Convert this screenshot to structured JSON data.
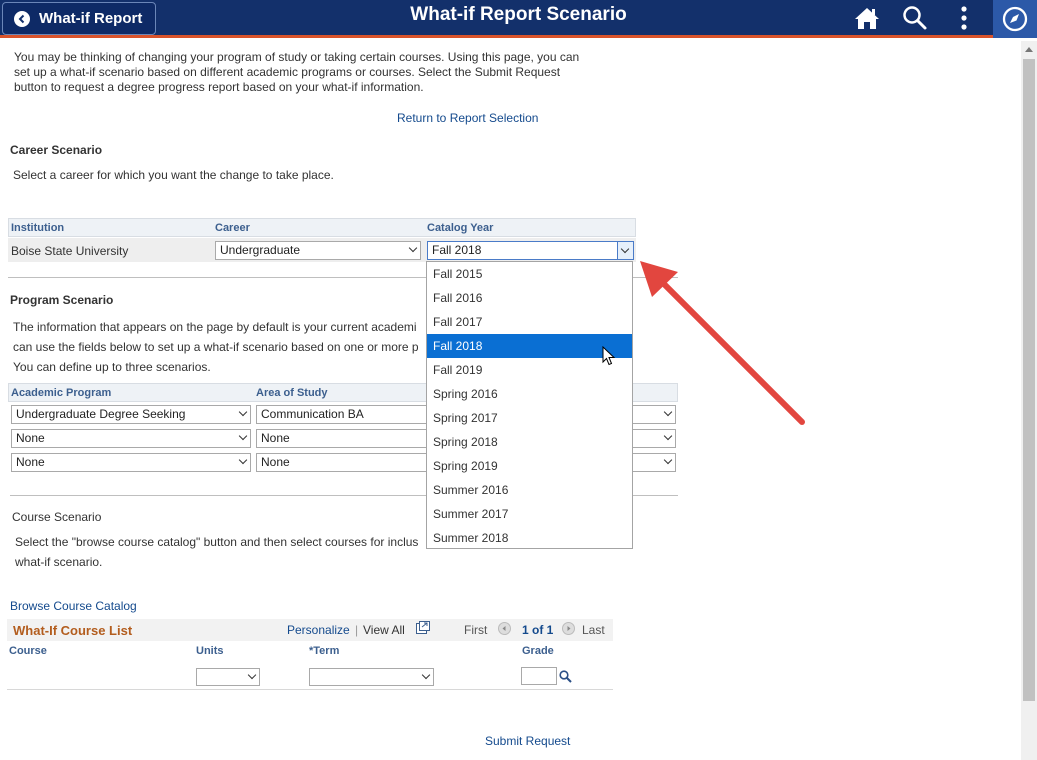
{
  "header": {
    "back_label": "What-if Report",
    "title": "What-if Report Scenario",
    "icons": [
      "home-icon",
      "search-icon",
      "more-icon",
      "compass-icon"
    ],
    "colors": {
      "bar": "#13306b",
      "accent_line": "#d9532b",
      "nav_btn": "#2c59a8",
      "selected": "#0a6fd3"
    }
  },
  "intro": {
    "line1": "You may be thinking of changing your program of study or taking certain courses. Using this page, you can",
    "line2": "set up a what-if scenario based on different academic programs or courses. Select the Submit Request",
    "line3": "button to request a degree progress report based on your what-if information."
  },
  "return_link": "Return to Report Selection",
  "career": {
    "heading": "Career Scenario",
    "instruction": "Select a career for which you want the change to take place.",
    "columns": [
      "Institution",
      "Career",
      "Catalog Year"
    ],
    "institution": "Boise State University",
    "career_value": "Undergraduate",
    "catalog_year_value": "Fall 2018"
  },
  "catalog_dropdown": {
    "options": [
      "Fall 2015",
      "Fall 2016",
      "Fall 2017",
      "Fall 2018",
      "Fall 2019",
      "Spring 2016",
      "Spring 2017",
      "Spring 2018",
      "Spring 2019",
      "Summer 2016",
      "Summer 2017",
      "Summer 2018"
    ],
    "selected": "Fall 2018"
  },
  "program": {
    "heading": "Program Scenario",
    "line1": "The information that appears on the page by default is your current academi",
    "line2": "can use the fields below to set up a what-if scenario based on one or more p",
    "line3": "You can define up to three scenarios.",
    "columns": [
      "Academic Program",
      "Area of Study"
    ],
    "rows": [
      {
        "program": "Undergraduate Degree Seeking",
        "area": "Communication BA"
      },
      {
        "program": "None",
        "area": "None"
      },
      {
        "program": "None",
        "area": "None"
      }
    ]
  },
  "course": {
    "heading": "Course Scenario",
    "line1": "Select the \"browse course catalog\" button and then select courses for inclus",
    "line2": "what-if scenario.",
    "browse_link": "Browse Course Catalog",
    "list_title": "What-If Course List",
    "personalize": "Personalize",
    "sep": "|",
    "view_all": "View All",
    "first": "First",
    "range": "1 of 1",
    "last": "Last",
    "columns": [
      "Course",
      "Units",
      "*Term",
      "Grade"
    ]
  },
  "submit": "Submit Request"
}
